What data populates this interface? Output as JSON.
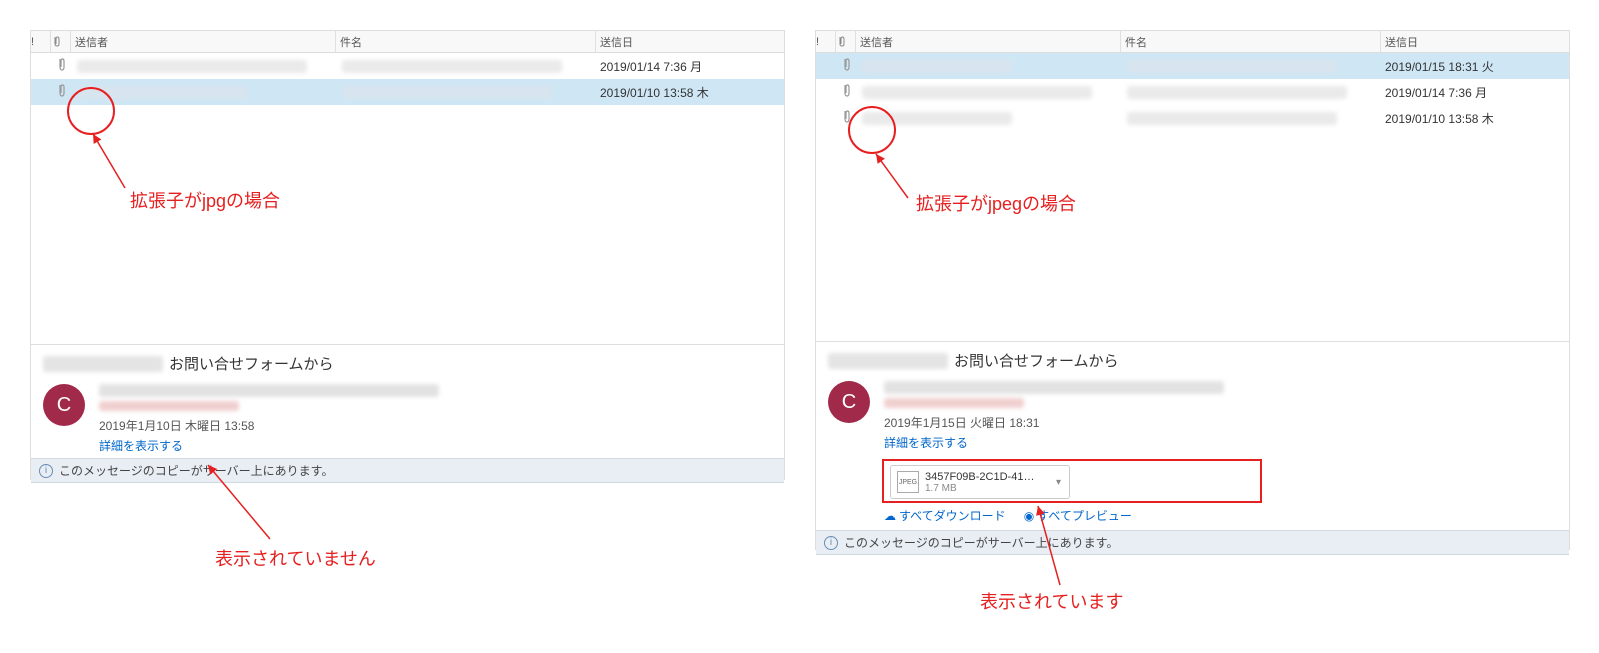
{
  "headers": {
    "importance": "!",
    "sender": "送信者",
    "subject": "件名",
    "date": "送信日"
  },
  "left": {
    "rows": [
      {
        "date": "2019/01/14 7:36 月",
        "selected": false
      },
      {
        "date": "2019/01/10 13:58 木",
        "selected": true
      }
    ],
    "annotation": "拡張子がjpgの場合",
    "preview": {
      "title_suffix": "お問い合せフォームから",
      "avatar_letter": "C",
      "date_line": "2019年1月10日 木曜日 13:58",
      "show_detail": "詳細を表示する",
      "info": "このメッセージのコピーがサーバー上にあります。"
    },
    "annotation2": "表示されていません"
  },
  "right": {
    "rows": [
      {
        "date": "2019/01/15 18:31 火",
        "selected": true
      },
      {
        "date": "2019/01/14 7:36 月",
        "selected": false
      },
      {
        "date": "2019/01/10 13:58 木",
        "selected": false
      }
    ],
    "annotation": "拡張子がjpegの場合",
    "preview": {
      "title_suffix": "お問い合せフォームから",
      "avatar_letter": "C",
      "date_line": "2019年1月15日 火曜日 18:31",
      "show_detail": "詳細を表示する",
      "attachment": {
        "name": "3457F09B-2C1D-41…",
        "size": "1.7 MB"
      },
      "download_all": "すべてダウンロード",
      "preview_all": "すべてプレビュー",
      "info": "このメッセージのコピーがサーバー上にあります。"
    },
    "annotation2": "表示されています"
  }
}
